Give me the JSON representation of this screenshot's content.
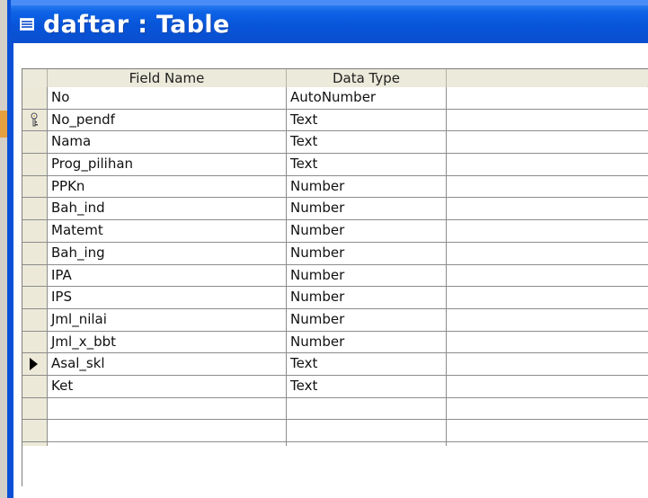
{
  "window": {
    "title": "daftar : Table"
  },
  "grid": {
    "columns": {
      "field_name": "Field Name",
      "data_type": "Data Type",
      "description": ""
    },
    "rows": [
      {
        "field_name": "No",
        "data_type": "AutoNumber",
        "description": "",
        "indicator": ""
      },
      {
        "field_name": "No_pendf",
        "data_type": "Text",
        "description": "",
        "indicator": "key-icon"
      },
      {
        "field_name": "Nama",
        "data_type": "Text",
        "description": "",
        "indicator": ""
      },
      {
        "field_name": "Prog_pilihan",
        "data_type": "Text",
        "description": "",
        "indicator": ""
      },
      {
        "field_name": "PPKn",
        "data_type": "Number",
        "description": "",
        "indicator": ""
      },
      {
        "field_name": "Bah_ind",
        "data_type": "Number",
        "description": "",
        "indicator": ""
      },
      {
        "field_name": "Matemt",
        "data_type": "Number",
        "description": "",
        "indicator": ""
      },
      {
        "field_name": "Bah_ing",
        "data_type": "Number",
        "description": "",
        "indicator": ""
      },
      {
        "field_name": "IPA",
        "data_type": "Number",
        "description": "",
        "indicator": ""
      },
      {
        "field_name": "IPS",
        "data_type": "Number",
        "description": "",
        "indicator": ""
      },
      {
        "field_name": "Jml_nilai",
        "data_type": "Number",
        "description": "",
        "indicator": ""
      },
      {
        "field_name": "Jml_x_bbt",
        "data_type": "Number",
        "description": "",
        "indicator": ""
      },
      {
        "field_name": "Asal_skl",
        "data_type": "Text",
        "description": "",
        "indicator": "record-pointer-icon"
      },
      {
        "field_name": "Ket",
        "data_type": "Text",
        "description": "",
        "indicator": ""
      },
      {
        "field_name": "",
        "data_type": "",
        "description": "",
        "indicator": ""
      },
      {
        "field_name": "",
        "data_type": "",
        "description": "",
        "indicator": ""
      },
      {
        "field_name": "",
        "data_type": "",
        "description": "",
        "indicator": ""
      }
    ]
  },
  "colors": {
    "title_bar": "#0754d8",
    "title_text": "#ffffff",
    "grid_header": "#ebeadb",
    "selector_column": "#ece9d8",
    "key_accent": "#c79b3b"
  }
}
